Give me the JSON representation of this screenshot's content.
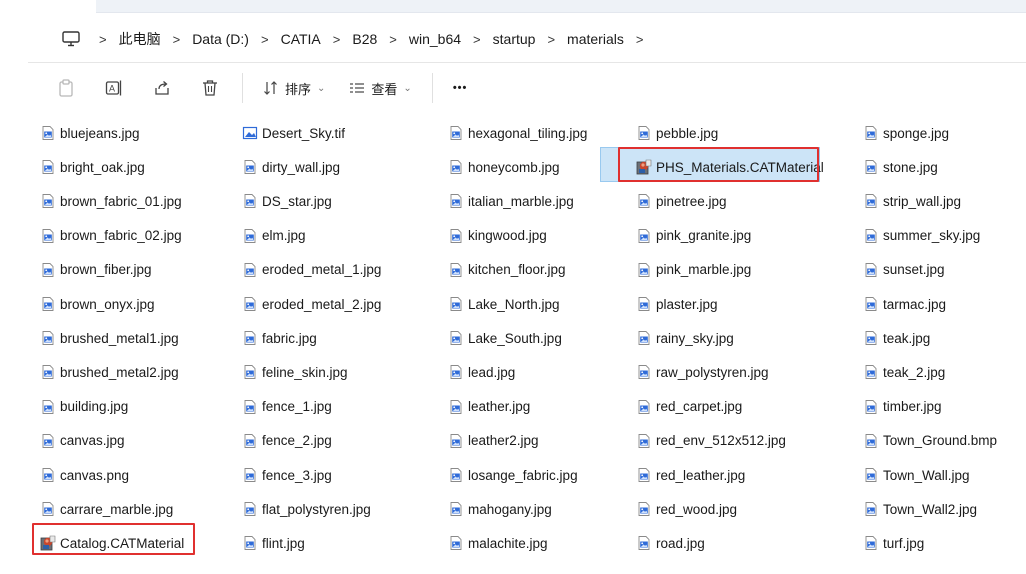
{
  "address": {
    "crumbs": [
      "此电脑",
      "Data (D:)",
      "CATIA",
      "B28",
      "win_b64",
      "startup",
      "materials"
    ],
    "separator": ">"
  },
  "toolbar": {
    "sort_label": "排序",
    "view_label": "查看",
    "more_label": "•••"
  },
  "colors": {
    "highlight": "#e0302f",
    "selection": "#cce4f7",
    "file_icon_blue": "#2f6bd8"
  },
  "columns": [
    [
      "bluejeans.jpg",
      "bright_oak.jpg",
      "brown_fabric_01.jpg",
      "brown_fabric_02.jpg",
      "brown_fiber.jpg",
      "brown_onyx.jpg",
      "brushed_metal1.jpg",
      "brushed_metal2.jpg",
      "building.jpg",
      "canvas.jpg",
      "canvas.png",
      "carrare_marble.jpg",
      "Catalog.CATMaterial"
    ],
    [
      "Desert_Sky.tif",
      "dirty_wall.jpg",
      "DS_star.jpg",
      "elm.jpg",
      "eroded_metal_1.jpg",
      "eroded_metal_2.jpg",
      "fabric.jpg",
      "feline_skin.jpg",
      "fence_1.jpg",
      "fence_2.jpg",
      "fence_3.jpg",
      "flat_polystyren.jpg",
      "flint.jpg"
    ],
    [
      "hexagonal_tiling.jpg",
      "honeycomb.jpg",
      "italian_marble.jpg",
      "kingwood.jpg",
      "kitchen_floor.jpg",
      "Lake_North.jpg",
      "Lake_South.jpg",
      "lead.jpg",
      "leather.jpg",
      "leather2.jpg",
      "losange_fabric.jpg",
      "mahogany.jpg",
      "malachite.jpg"
    ],
    [
      "pebble.jpg",
      "PHS_Materials.CATMaterial",
      "pinetree.jpg",
      "pink_granite.jpg",
      "pink_marble.jpg",
      "plaster.jpg",
      "rainy_sky.jpg",
      "raw_polystyren.jpg",
      "red_carpet.jpg",
      "red_env_512x512.jpg",
      "red_leather.jpg",
      "red_wood.jpg",
      "road.jpg"
    ],
    [
      "sponge.jpg",
      "stone.jpg",
      "strip_wall.jpg",
      "summer_sky.jpg",
      "sunset.jpg",
      "tarmac.jpg",
      "teak.jpg",
      "teak_2.jpg",
      "timber.jpg",
      "Town_Ground.bmp",
      "Town_Wall.jpg",
      "Town_Wall2.jpg",
      "turf.jpg"
    ]
  ]
}
